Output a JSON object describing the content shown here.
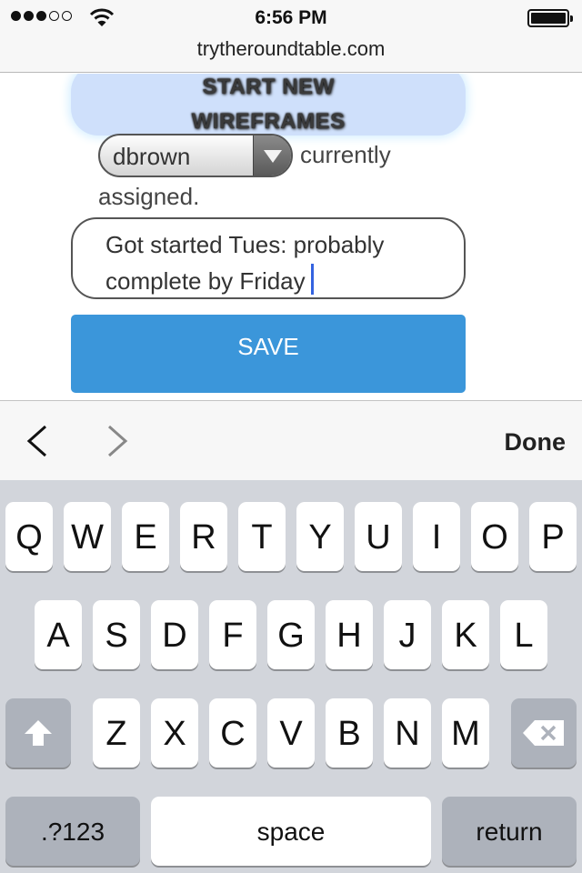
{
  "status": {
    "time": "6:56 PM",
    "signal_dots": [
      true,
      true,
      true,
      false,
      false
    ],
    "wifi_icon": "wifi-icon",
    "battery_icon": "battery-full-icon"
  },
  "browser": {
    "url": "trytheroundtable.com"
  },
  "page": {
    "start_button_line1": "START NEW",
    "start_button_line2": "WIREFRAMES",
    "assignee_select_value": "dbrown",
    "assigned_text_a": "currently",
    "assigned_text_b": "assigned.",
    "note_line1": "Got started Tues: probably",
    "note_line2": "complete by Friday",
    "save_label": "SAVE"
  },
  "accessory": {
    "prev_icon": "chevron-left-icon",
    "next_icon": "chevron-right-icon",
    "done_label": "Done"
  },
  "keyboard": {
    "row1": [
      "Q",
      "W",
      "E",
      "R",
      "T",
      "Y",
      "U",
      "I",
      "O",
      "P"
    ],
    "row2": [
      "A",
      "S",
      "D",
      "F",
      "G",
      "H",
      "J",
      "K",
      "L"
    ],
    "row3": [
      "Z",
      "X",
      "C",
      "V",
      "B",
      "N",
      "M"
    ],
    "shift_icon": "shift-up-arrow-icon",
    "backspace_icon": "backspace-icon",
    "numbers_label": ".?123",
    "space_label": "space",
    "return_label": "return"
  },
  "colors": {
    "save_button": "#3b96da",
    "start_button": "#cfe0fb",
    "caret": "#3463e0",
    "keyboard_bg": "#d2d5db"
  }
}
